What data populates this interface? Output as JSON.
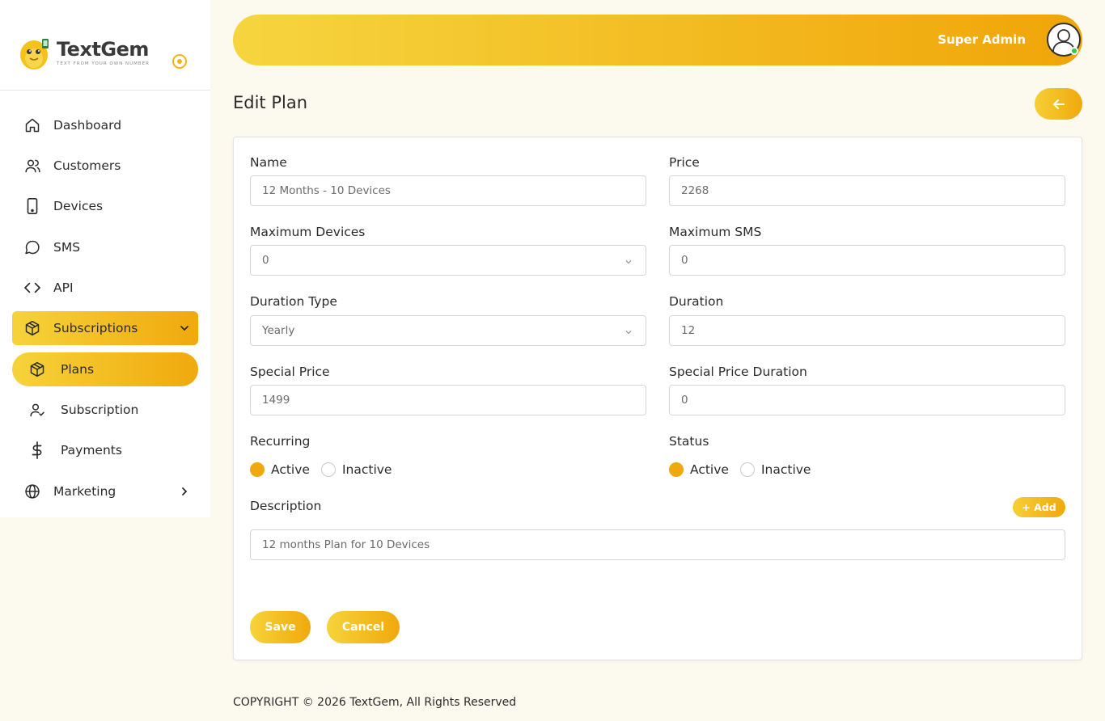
{
  "brand": {
    "name": "TextGem",
    "tagline": "TEXT FROM YOUR OWN NUMBER"
  },
  "sidebar": {
    "items": [
      {
        "label": "Dashboard",
        "icon": "home-icon"
      },
      {
        "label": "Customers",
        "icon": "users-icon"
      },
      {
        "label": "Devices",
        "icon": "phone-icon"
      },
      {
        "label": "SMS",
        "icon": "chat-icon"
      },
      {
        "label": "API",
        "icon": "code-icon"
      },
      {
        "label": "Subscriptions",
        "icon": "box-icon",
        "expanded": true
      },
      {
        "label": "Plans",
        "icon": "box-icon",
        "active": true
      },
      {
        "label": "Subscription",
        "icon": "user-check-icon"
      },
      {
        "label": "Payments",
        "icon": "dollar-icon"
      },
      {
        "label": "Marketing",
        "icon": "globe-icon"
      }
    ]
  },
  "header": {
    "user_name": "Super Admin",
    "user_status": "online"
  },
  "page": {
    "title": "Edit Plan"
  },
  "form": {
    "name": {
      "label": "Name",
      "value": "12 Months - 10 Devices"
    },
    "price": {
      "label": "Price",
      "value": "2268"
    },
    "max_devices": {
      "label": "Maximum Devices",
      "value": "0"
    },
    "max_sms": {
      "label": "Maximum SMS",
      "value": "0"
    },
    "duration_type": {
      "label": "Duration Type",
      "value": "Yearly"
    },
    "duration": {
      "label": "Duration",
      "value": "12"
    },
    "special_price": {
      "label": "Special Price",
      "value": "1499"
    },
    "special_price_duration": {
      "label": "Special Price Duration",
      "value": "0"
    },
    "recurring": {
      "label": "Recurring",
      "options": [
        "Active",
        "Inactive"
      ],
      "selected": "Active"
    },
    "status": {
      "label": "Status",
      "options": [
        "Active",
        "Inactive"
      ],
      "selected": "Active"
    },
    "description": {
      "label": "Description",
      "add_label": "+ Add",
      "value": "12 months Plan for 10 Devices"
    },
    "save_label": "Save",
    "cancel_label": "Cancel"
  },
  "footer": {
    "text": "COPYRIGHT © 2026 TextGem, All Rights Reserved"
  },
  "colors": {
    "accent_start": "#f6d33a",
    "accent_end": "#f0a90c",
    "background": "#fcf9ef"
  }
}
